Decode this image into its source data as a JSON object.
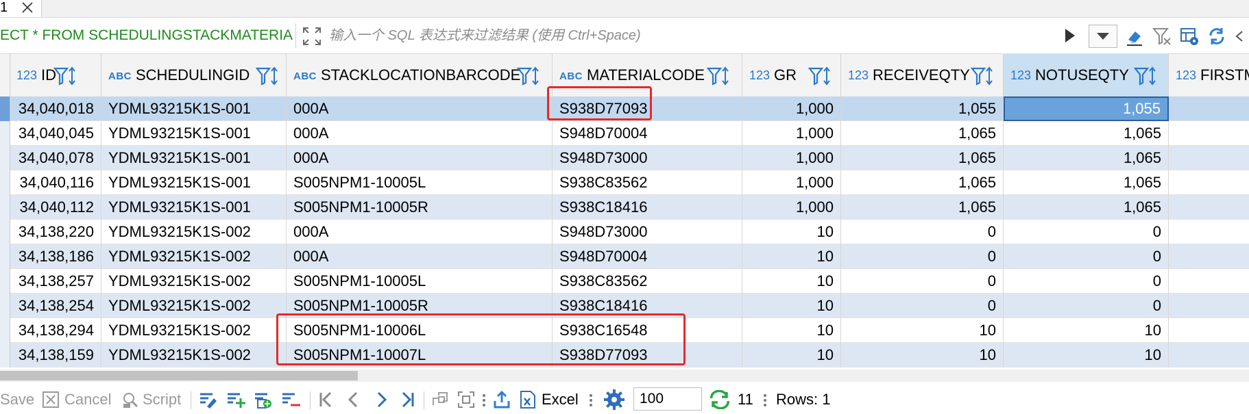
{
  "tab": {
    "label": "1"
  },
  "filter": {
    "sql_text": "ECT * FROM SCHEDULINGSTACKMATERIAL",
    "placeholder": "输入一个 SQL 表达式来过滤结果 (使用 Ctrl+Space)"
  },
  "grid": {
    "columns": [
      {
        "type": "123",
        "name": "ID"
      },
      {
        "type": "ABC",
        "name": "SCHEDULINGID"
      },
      {
        "type": "ABC",
        "name": "STACKLOCATIONBARCODE"
      },
      {
        "type": "ABC",
        "name": "MATERIALCODE"
      },
      {
        "type": "123",
        "name": "GR"
      },
      {
        "type": "123",
        "name": "RECEIVEQTY"
      },
      {
        "type": "123",
        "name": "NOTUSEQTY"
      },
      {
        "type": "123",
        "name": "FIRSTM"
      }
    ],
    "rows": [
      [
        "34,040,018",
        "YDML93215K1S-001",
        "000A",
        "S938D77093",
        "1,000",
        "1,055",
        "1,055"
      ],
      [
        "34,040,045",
        "YDML93215K1S-001",
        "000A",
        "S948D70004",
        "1,000",
        "1,065",
        "1,065"
      ],
      [
        "34,040,078",
        "YDML93215K1S-001",
        "000A",
        "S948D73000",
        "1,000",
        "1,065",
        "1,065"
      ],
      [
        "34,040,116",
        "YDML93215K1S-001",
        "S005NPM1-10005L",
        "S938C83562",
        "1,000",
        "1,065",
        "1,065"
      ],
      [
        "34,040,112",
        "YDML93215K1S-001",
        "S005NPM1-10005R",
        "S938C18416",
        "1,000",
        "1,065",
        "1,065"
      ],
      [
        "34,138,220",
        "YDML93215K1S-002",
        "000A",
        "S948D73000",
        "10",
        "0",
        "0"
      ],
      [
        "34,138,186",
        "YDML93215K1S-002",
        "000A",
        "S948D70004",
        "10",
        "0",
        "0"
      ],
      [
        "34,138,257",
        "YDML93215K1S-002",
        "S005NPM1-10005L",
        "S938C83562",
        "10",
        "0",
        "0"
      ],
      [
        "34,138,254",
        "YDML93215K1S-002",
        "S005NPM1-10005R",
        "S938C18416",
        "10",
        "0",
        "0"
      ],
      [
        "34,138,294",
        "YDML93215K1S-002",
        "S005NPM1-10006L",
        "S938C16548",
        "10",
        "10",
        "10"
      ],
      [
        "34,138,159",
        "YDML93215K1S-002",
        "S005NPM1-10007L",
        "S938D77093",
        "10",
        "10",
        "10"
      ]
    ]
  },
  "toolbar": {
    "save": "Save",
    "cancel": "Cancel",
    "script": "Script",
    "excel": "Excel",
    "fetch_size": "100",
    "refresh_count": "11",
    "rows_label": "Rows: 1"
  },
  "colors": {
    "sql_text": "#1e8a1e",
    "type_icon": "#2a78c8",
    "highlight_box": "#e52a2a",
    "selected_cell": "#6aa3dc",
    "alt_row": "#dde7f3"
  },
  "icons": [
    "close-icon",
    "expand-icon",
    "run-icon",
    "dropdown-icon",
    "eraser-icon",
    "filter-clear-icon",
    "panel-settings-icon",
    "refresh-icon",
    "filter-funnel-icon",
    "sort-arrows-icon",
    "first-page-icon",
    "prev-page-icon",
    "next-page-icon",
    "last-page-icon",
    "export-icon",
    "gear-icon",
    "auto-refresh-icon"
  ]
}
